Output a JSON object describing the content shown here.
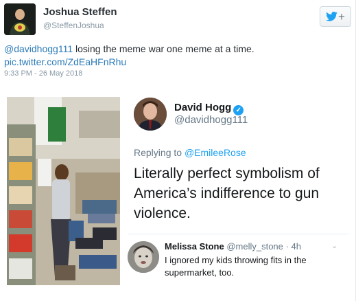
{
  "tweet": {
    "author_name": "Joshua Steffen",
    "author_handle": "@SteffenJoshua",
    "mention": "@davidhogg111",
    "text": " losing the meme war one meme at a time.",
    "link": "pic.twitter.com/ZdEaHFnRhu",
    "timestamp": "9:33 PM - 26 May 2018"
  },
  "follow_button": {
    "icon": "twitter-bird-icon",
    "symbol": "+"
  },
  "embedded": {
    "author_name": "David Hogg",
    "author_handle": "@davidhogg111",
    "replying_to_prefix": "Replying to ",
    "replying_to": "@EmileeRose",
    "body": "Literally perfect symbolism of America’s indifference to gun violence.",
    "reply": {
      "author_name": "Melissa Stone",
      "author_handle": "@melly_stone",
      "age": " · 4h",
      "body": "I ignored my kids throwing fits in the supermarket, too."
    }
  },
  "colors": {
    "link": "#2b7bb9",
    "verified": "#1da1f2",
    "muted": "#8899a6"
  }
}
